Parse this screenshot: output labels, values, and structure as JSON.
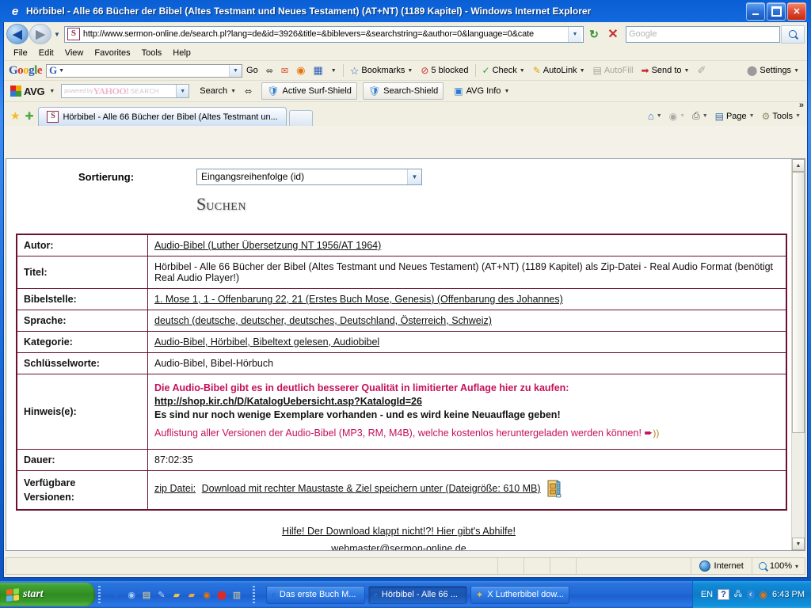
{
  "window": {
    "title": "Hörbibel - Alle 66 Bücher der Bibel (Altes Testmant und Neues Testament) (AT+NT) (1189 Kapitel) - Windows Internet Explorer",
    "minimize_label": "_",
    "maximize_label": "❐",
    "close_label": "✕"
  },
  "address_bar": {
    "url": "http://www.sermon-online.de/search.pl?lang=de&id=3926&title=&biblevers=&searchstring=&author=0&language=0&cate",
    "favicon_letter": "S",
    "back_label": "◀",
    "forward_label": "▶",
    "refresh_label": "↻",
    "stop_label": "✕",
    "search_placeholder": "Google",
    "dropdown_label": "▼"
  },
  "menubar": {
    "items": [
      "File",
      "Edit",
      "View",
      "Favorites",
      "Tools",
      "Help"
    ]
  },
  "google_toolbar": {
    "logo": "Google",
    "search_value": "",
    "search_icon_letter": "G",
    "go_label": "Go",
    "bookmarks_label": "Bookmarks",
    "blocked_label": "5 blocked",
    "check_label": "Check",
    "autolink_label": "AutoLink",
    "autofill_label": "AutoFill",
    "sendto_label": "Send to",
    "settings_label": "Settings"
  },
  "avg_toolbar": {
    "logo": "AVG",
    "yahoo_powered": "powered by",
    "yahoo_brand": "YAHOO!",
    "yahoo_search": "SEARCH",
    "search_label": "Search",
    "surfshield_label": "Active  Surf-Shield",
    "searchshield_label": "Search-Shield",
    "avginfo_label": "AVG Info"
  },
  "tabs": {
    "favorites_label": "★",
    "add_favorite_label": "✚",
    "items": [
      {
        "label": "Hörbibel - Alle 66 Bücher der Bibel (Altes Testmant un...",
        "favicon_letter": "S",
        "active": true
      }
    ],
    "new_tab_label": ""
  },
  "command_bar": {
    "home_label": "⌂",
    "feeds_label": "",
    "print_label": "",
    "page_label": "Page",
    "tools_label": "Tools",
    "overflow_label": "»"
  },
  "page": {
    "sort": {
      "label": "Sortierung:",
      "selected": "Eingangsreihenfolge (id)"
    },
    "search_button": {
      "cap": "S",
      "rest": "UCHEN"
    },
    "detail_rows": [
      {
        "label": "Autor:",
        "type": "link",
        "value": "Audio-Bibel (Luther Übersetzung NT 1956/AT 1964)"
      },
      {
        "label": "Titel:",
        "type": "text",
        "value": "Hörbibel - Alle 66 Bücher der Bibel (Altes Testmant und Neues Testament) (AT+NT) (1189 Kapitel) als Zip-Datei - Real Audio Format (benötigt Real Audio Player!)"
      },
      {
        "label": "Bibelstelle:",
        "type": "link",
        "value": "1. Mose 1, 1 - Offenbarung 22, 21 (Erstes Buch Mose, Genesis) (Offenbarung des Johannes)"
      },
      {
        "label": "Sprache:",
        "type": "link",
        "value": "deutsch (deutsche, deutscher, deutsches, Deutschland, Österreich, Schweiz)"
      },
      {
        "label": "Kategorie:",
        "type": "link",
        "value": "Audio-Bibel, Hörbibel, Bibeltext gelesen, Audiobibel"
      },
      {
        "label": "Schlüsselworte:",
        "type": "text",
        "value": "Audio-Bibel, Bibel-Hörbuch"
      }
    ],
    "hinweis": {
      "label": "Hinweis(e):",
      "line1": "Die Audio-Bibel gibt es in deutlich besserer Qualität in limitierter Auflage hier zu kaufen:",
      "line2": "http://shop.kir.ch/D/KatalogUebersicht.asp?KatalogId=26",
      "line3": "Es sind nur noch wenige Exemplare vorhanden - und es wird keine Neuauflage geben!",
      "line4": "Auflistung aller Versionen der Audio-Bibel (MP3, RM, M4B), welche kostenlos heruntergeladen werden können!",
      "arrow": "➨"
    },
    "dauer": {
      "label": "Dauer:",
      "value": "87:02:35"
    },
    "versionen": {
      "label_line1": "Verfügbare",
      "label_line2": "Versionen:",
      "prefix": "zip Datei:",
      "link": "Download mit rechter Maustaste & Ziel speichern unter (Dateigröße: 610 MB)"
    },
    "footer_links": [
      "Hilfe! Der Download klappt nicht!?! Hier gibt's Abhilfe!",
      "webmaster@sermon-online.de"
    ]
  },
  "status_bar": {
    "zone": "Internet",
    "zoom": "100%",
    "zoom_caret": "▾"
  },
  "taskbar": {
    "start_label": "start",
    "items": [
      {
        "label": "Das erste Buch M...",
        "icon": "ie-icon",
        "active": false
      },
      {
        "label": "Hörbibel - Alle 66 ...",
        "icon": "ie-icon",
        "active": true
      },
      {
        "label": "X Lutherbibel dow...",
        "icon": "app-icon",
        "active": false
      }
    ],
    "tray": {
      "language": "EN",
      "clock": "6:43 PM"
    }
  },
  "colors": {
    "table_border": "#6b1030",
    "accent_red": "#c4105a",
    "title_bar_blue": "#1b72e8",
    "taskbar_blue": "#2169d8",
    "start_green": "#2f8c22"
  }
}
